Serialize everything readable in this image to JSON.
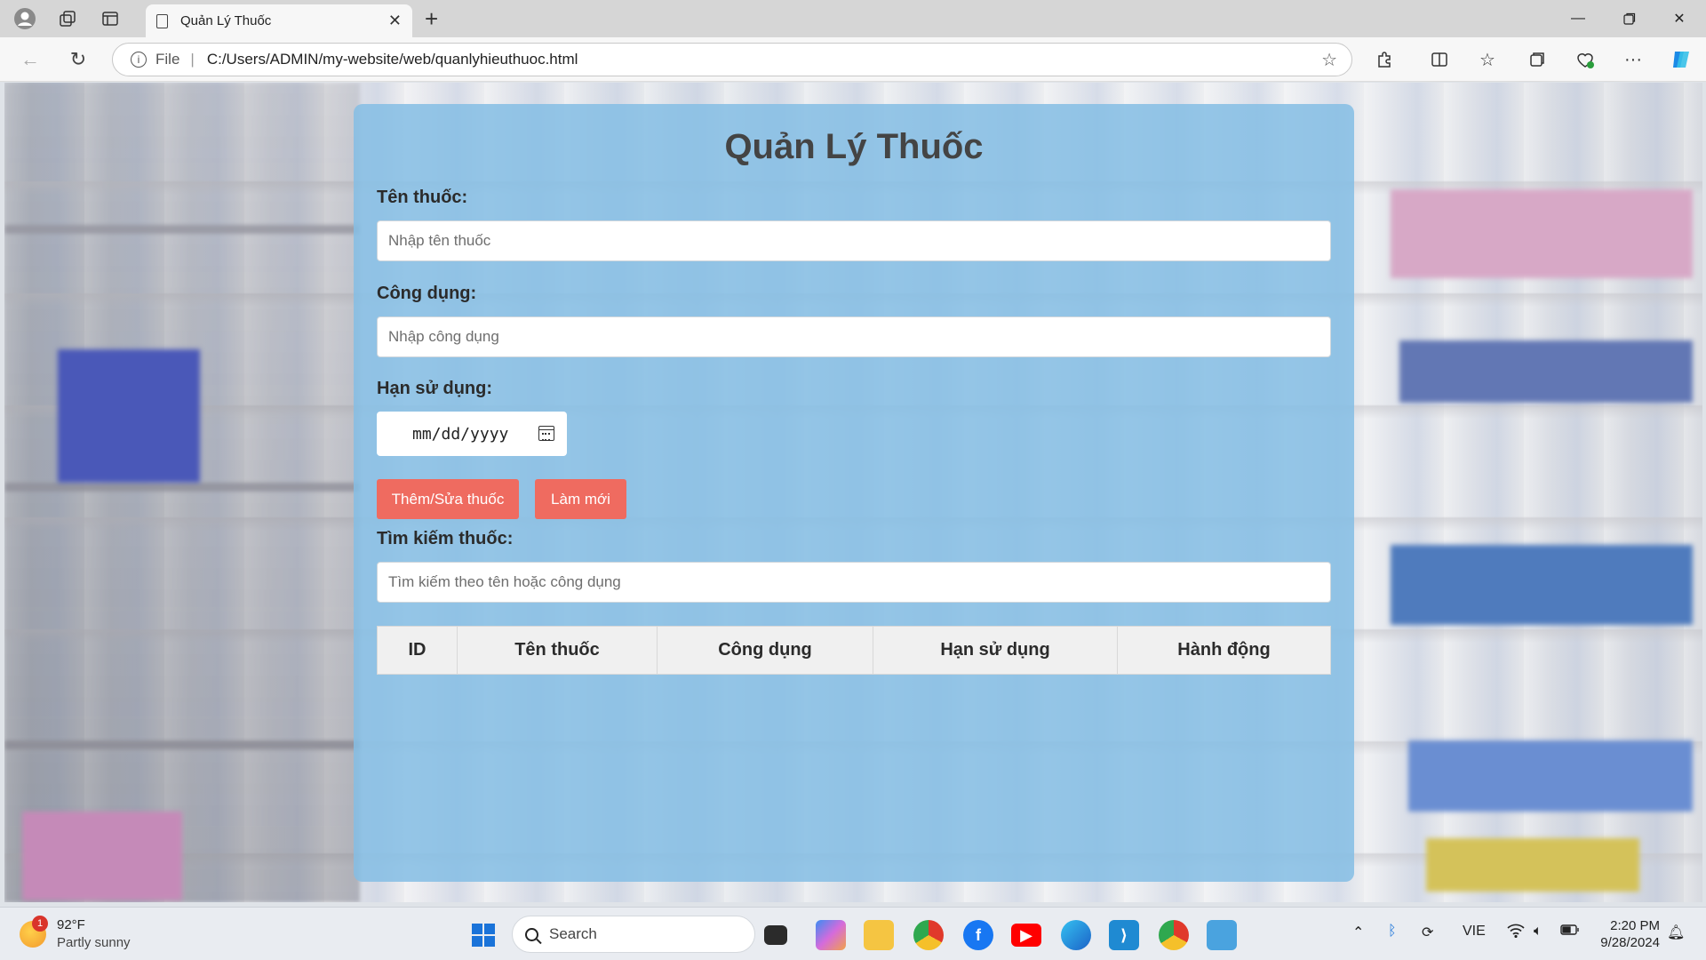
{
  "browser": {
    "tab_title": "Quản Lý Thuốc",
    "address_scheme": "File",
    "address_url": "C:/Users/ADMIN/my-website/web/quanlyhieuthuoc.html"
  },
  "app": {
    "title": "Quản Lý Thuốc",
    "name_label": "Tên thuốc:",
    "name_placeholder": "Nhập tên thuốc",
    "usage_label": "Công dụng:",
    "usage_placeholder": "Nhập công dụng",
    "expiry_label": "Hạn sử dụng:",
    "expiry_placeholder": "mm/dd/yyyy",
    "add_button": "Thêm/Sửa thuốc",
    "reset_button": "Làm mới",
    "search_label": "Tìm kiếm thuốc:",
    "search_placeholder": "Tìm kiếm theo tên hoặc công dụng",
    "table_headers": [
      "ID",
      "Tên thuốc",
      "Công dụng",
      "Hạn sử dụng",
      "Hành động"
    ]
  },
  "taskbar": {
    "weather_temp": "92°F",
    "weather_desc": "Partly sunny",
    "weather_badge": "1",
    "search_label": "Search",
    "language": "VIE",
    "time": "2:20 PM",
    "date": "9/28/2024"
  },
  "colors": {
    "panel": "#85bee4",
    "button": "#ef6b60",
    "table_header": "#f0f0f0"
  }
}
